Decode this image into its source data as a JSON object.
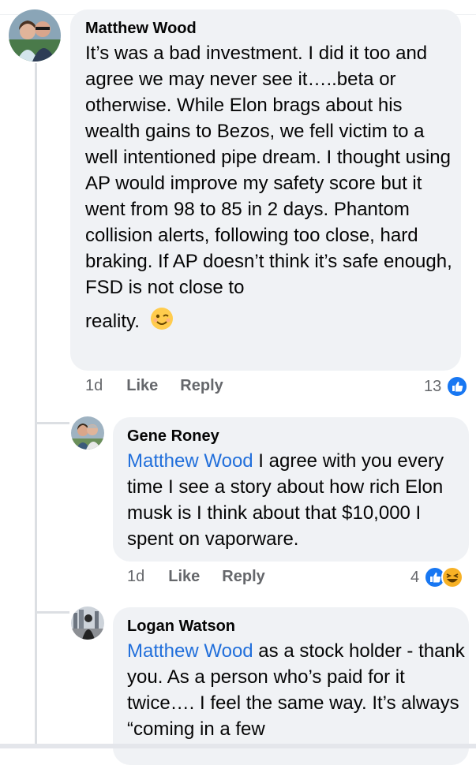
{
  "comments": [
    {
      "author": "Matthew Wood",
      "text": "It’s was a bad investment. I did it too and agree we may never see it…..beta or otherwise. While Elon brags about his wealth gains to Bezos, we fell victim to a well intentioned pipe dream. I thought using AP would improve my safety score but it went from 98 to 85 in 2 days. Phantom collision alerts, following too close, hard braking. If AP doesn’t think it’s safe enough, FSD is not close to",
      "text_last": "reality.",
      "time": "1d",
      "like": "Like",
      "reply": "Reply",
      "reaction_count": "13"
    }
  ],
  "replies": [
    {
      "author": "Gene Roney",
      "mention": "Matthew Wood",
      "text": " I agree with you every time I see a story about how rich Elon musk is I think about that $10,000 I spent on vaporware.",
      "time": "1d",
      "like": "Like",
      "reply": "Reply",
      "reaction_count": "4"
    },
    {
      "author": "Logan Watson",
      "mention": "Matthew Wood",
      "text": " as a stock holder - thank you. As a person who’s paid for it twice…. I feel the same way. It’s always “coming in a few"
    }
  ],
  "colors": {
    "mention": "#216fdb",
    "bubble": "#f0f2f5",
    "like_blue": "#1877f2",
    "haha_yellow": "#f7b125"
  },
  "icons": {
    "like": "like-reaction-icon",
    "haha": "haha-reaction-icon",
    "wink": "wink-emoji-icon"
  }
}
